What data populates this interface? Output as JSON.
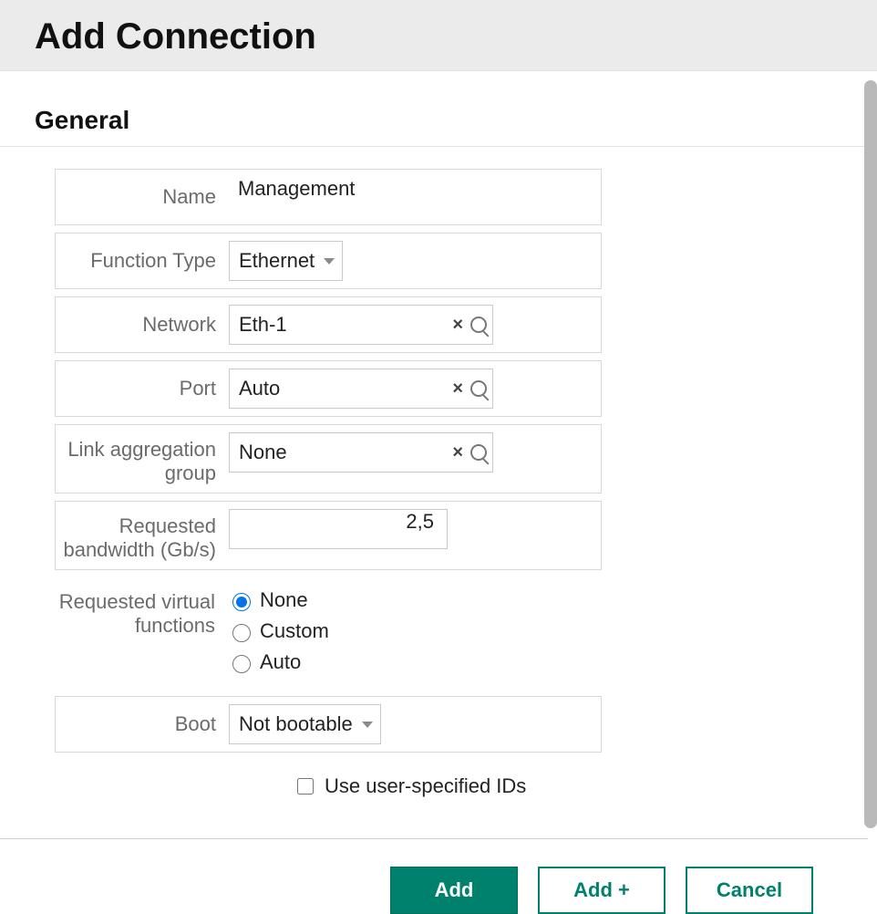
{
  "header": {
    "title": "Add Connection"
  },
  "section": {
    "title": "General"
  },
  "fields": {
    "name": {
      "label": "Name",
      "value": "Management"
    },
    "function_type": {
      "label": "Function Type",
      "value": "Ethernet"
    },
    "network": {
      "label": "Network",
      "value": "Eth-1"
    },
    "port": {
      "label": "Port",
      "value": "Auto"
    },
    "lag": {
      "label": "Link aggregation group",
      "value": "None"
    },
    "bandwidth": {
      "label": "Requested bandwidth (Gb/s)",
      "value": "2,5"
    },
    "rvf": {
      "label": "Requested virtual functions",
      "options": {
        "none": "None",
        "custom": "Custom",
        "auto": "Auto"
      }
    },
    "boot": {
      "label": "Boot",
      "value": "Not bootable"
    },
    "use_ids": {
      "label": "Use user-specified IDs"
    }
  },
  "buttons": {
    "add": "Add",
    "add_plus": "Add +",
    "cancel": "Cancel"
  }
}
